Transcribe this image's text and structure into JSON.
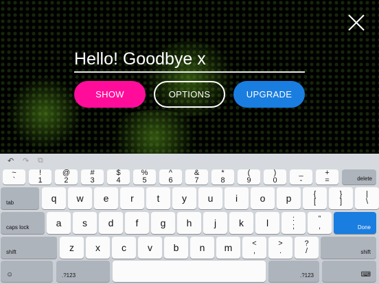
{
  "display": {
    "message": "Hello! Goodbye x",
    "buttons": {
      "show": "SHOW",
      "options": "OPTIONS",
      "upgrade": "UPGRADE"
    }
  },
  "keyboard": {
    "toolbar": [
      "undo-icon",
      "redo-icon",
      "paste-icon"
    ],
    "row_numbers": [
      {
        "top": "~",
        "bottom": "`"
      },
      {
        "top": "!",
        "bottom": "1"
      },
      {
        "top": "@",
        "bottom": "2"
      },
      {
        "top": "#",
        "bottom": "3"
      },
      {
        "top": "$",
        "bottom": "4"
      },
      {
        "top": "%",
        "bottom": "5"
      },
      {
        "top": "^",
        "bottom": "6"
      },
      {
        "top": "&",
        "bottom": "7"
      },
      {
        "top": "*",
        "bottom": "8"
      },
      {
        "top": "(",
        "bottom": "9"
      },
      {
        "top": ")",
        "bottom": "0"
      },
      {
        "top": "_",
        "bottom": "-"
      },
      {
        "top": "+",
        "bottom": "="
      }
    ],
    "delete": "delete",
    "tab": "tab",
    "row_qwerty": [
      "q",
      "w",
      "e",
      "r",
      "t",
      "y",
      "u",
      "i",
      "o",
      "p"
    ],
    "row_qwerty_extra": [
      {
        "top": "{",
        "bottom": "["
      },
      {
        "top": "}",
        "bottom": "]"
      },
      {
        "top": "|",
        "bottom": "\\"
      }
    ],
    "caps": "caps lock",
    "row_asdf": [
      "a",
      "s",
      "d",
      "f",
      "g",
      "h",
      "j",
      "k",
      "l"
    ],
    "row_asdf_extra": [
      {
        "top": ":",
        "bottom": ";"
      },
      {
        "top": "”",
        "bottom": ","
      }
    ],
    "done": "Done",
    "shift": "shift",
    "row_zxcv": [
      "z",
      "x",
      "c",
      "v",
      "b",
      "n",
      "m"
    ],
    "row_zxcv_extra": [
      {
        "top": "<",
        "bottom": ","
      },
      {
        "top": ">",
        "bottom": "."
      },
      {
        "top": "?",
        "bottom": "/"
      }
    ],
    "mode_left": ".?123",
    "mode_right": ".?123",
    "emoji": "emoji-icon"
  }
}
